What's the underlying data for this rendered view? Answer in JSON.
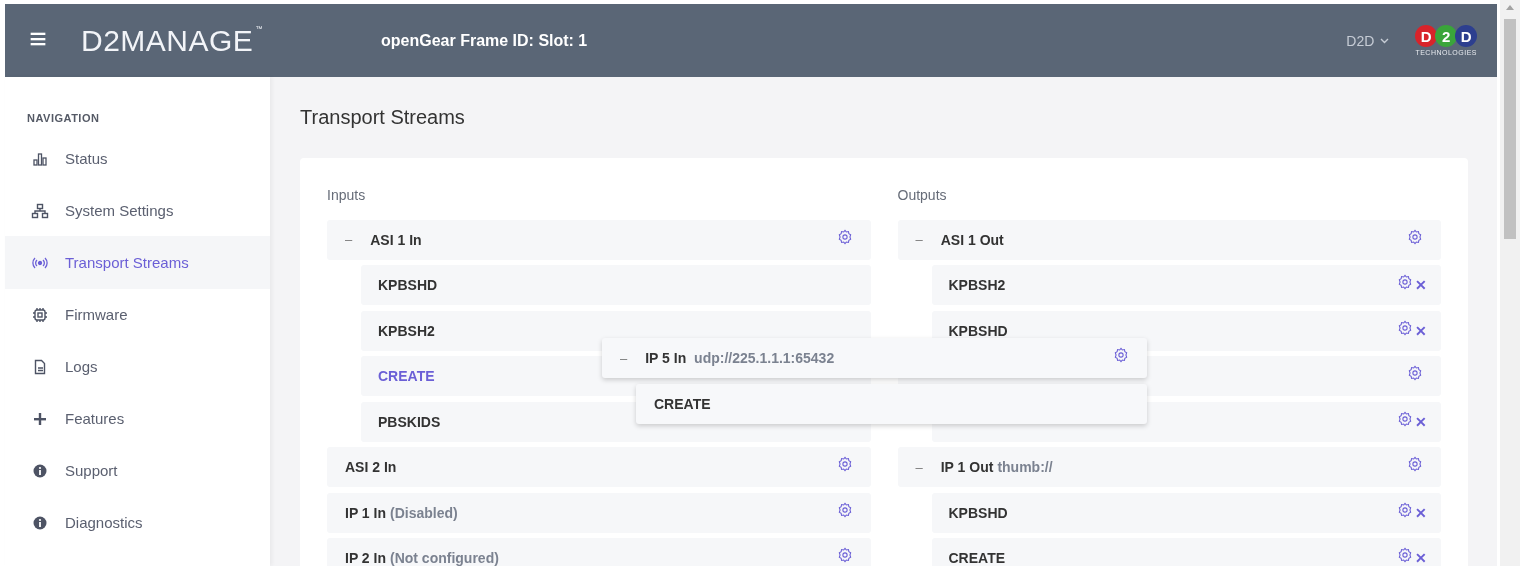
{
  "header": {
    "menu_glyph": "≡",
    "logo": "D2MANAGE",
    "logo_mark": "™",
    "title": "openGear Frame ID: Slot: 1",
    "user": "D2D",
    "brand": {
      "letters": [
        "D",
        "2",
        "D"
      ],
      "caption": "TECHNOLOGIES"
    }
  },
  "sidebar": {
    "heading": "NAVIGATION",
    "items": [
      {
        "label": "Status",
        "selected": false
      },
      {
        "label": "System Settings",
        "selected": false
      },
      {
        "label": "Transport Streams",
        "selected": true
      },
      {
        "label": "Firmware",
        "selected": false
      },
      {
        "label": "Logs",
        "selected": false
      },
      {
        "label": "Features",
        "selected": false
      },
      {
        "label": "Support",
        "selected": false
      },
      {
        "label": "Diagnostics",
        "selected": false
      }
    ]
  },
  "page_title": "Transport Streams",
  "inputs": {
    "heading": "Inputs",
    "streams": [
      {
        "name": "ASI 1 In",
        "expanded": true,
        "children": [
          {
            "name": "KPBSHD",
            "highlighted": false,
            "removable": false
          },
          {
            "name": "KPBSH2",
            "highlighted": false,
            "removable": false
          },
          {
            "name": "CREATE",
            "highlighted": true,
            "removable": false
          },
          {
            "name": "PBSKIDS",
            "highlighted": false,
            "removable": false
          }
        ]
      },
      {
        "name": "ASI 2 In"
      },
      {
        "name": "IP 1 In",
        "note": "(Disabled)"
      },
      {
        "name": "IP 2 In",
        "note": "(Not configured)"
      }
    ]
  },
  "outputs": {
    "heading": "Outputs",
    "streams": [
      {
        "name": "ASI 1 Out",
        "expanded": true,
        "children": [
          {
            "name": "KPBSH2",
            "highlighted": false,
            "removable": true
          },
          {
            "name": "KPBSHD",
            "highlighted": false,
            "removable": true
          }
        ]
      },
      {
        "expanded": true,
        "children": [
          {
            "highlighted": false,
            "removable": true
          }
        ]
      },
      {
        "name": "IP 1 Out",
        "note": "thumb://",
        "expanded": true,
        "children": [
          {
            "name": "KPBSHD",
            "highlighted": false,
            "removable": true
          },
          {
            "name": "CREATE",
            "highlighted": false,
            "removable": true
          }
        ]
      }
    ]
  },
  "dragged": {
    "name": "IP 5 In",
    "note": "udp://225.1.1.1:65432",
    "expanded": true,
    "children": [
      {
        "name": "CREATE",
        "highlighted": false
      }
    ]
  },
  "glyphs": {
    "collapse": "–",
    "remove": "✕"
  }
}
